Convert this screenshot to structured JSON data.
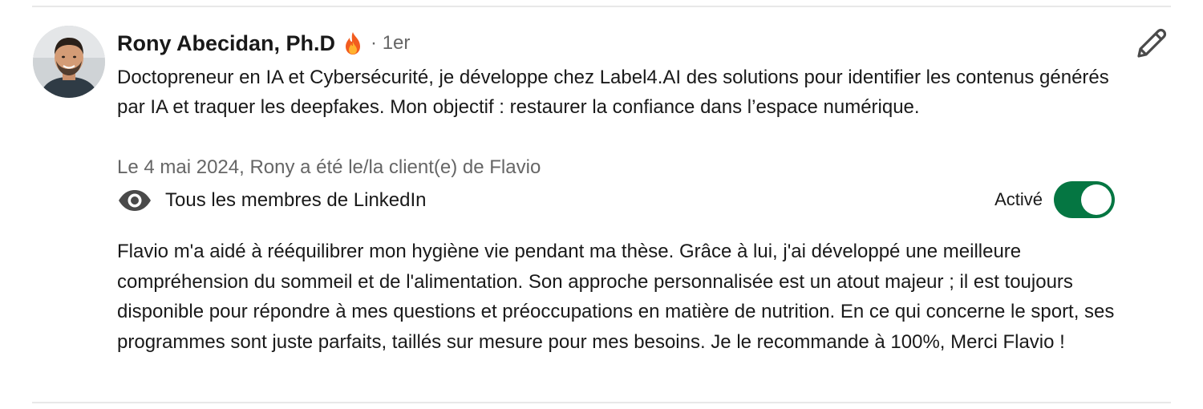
{
  "recommendation": {
    "author_name": "Rony Abecidan, Ph.D",
    "name_emoji": "fire-emoji",
    "degree": "· 1er",
    "headline": "Doctopreneur en IA et Cybersécurité, je développe chez Label4.AI des solutions pour identifier les contenus générés par IA et traquer les deepfakes. Mon objectif : restaurer la confiance dans l’espace numérique.",
    "relationship": "Le 4 mai 2024, Rony a été le/la client(e) de Flavio",
    "visibility_icon": "eye-icon",
    "visibility_label": "Tous les membres de LinkedIn",
    "toggle": {
      "label": "Activé",
      "state": "on",
      "color": "#057642"
    },
    "edit_icon": "pencil-icon",
    "text": "Flavio m'a aidé à rééquilibrer mon hygiène vie pendant ma thèse. Grâce à lui, j'ai développé une meilleure compréhension du sommeil et de l'alimentation. Son approche personnalisée est un atout majeur ; il est toujours disponible pour répondre à mes questions et préoccupations en matière de nutrition. En ce qui concerne le sport, ses programmes sont juste parfaits, taillés sur mesure pour mes besoins. Je le recommande à 100%, Merci Flavio !"
  }
}
